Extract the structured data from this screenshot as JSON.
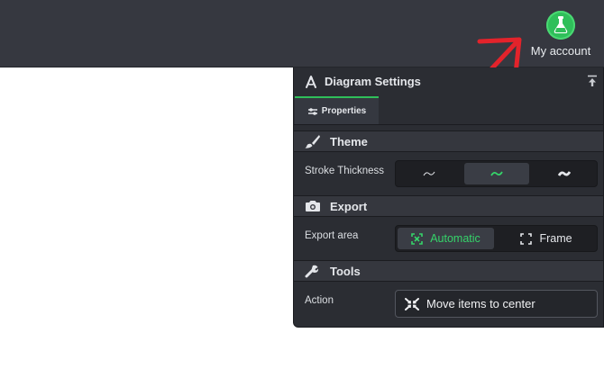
{
  "account": {
    "label": "My account",
    "icon": "flask-avatar-icon",
    "accent": "#2fbf5a"
  },
  "panel": {
    "title": "Diagram Settings",
    "title_icon": "compass-icon",
    "pin_icon": "pin-icon",
    "tabs": [
      {
        "label": "Properties",
        "icon": "sliders-icon",
        "active": true
      }
    ],
    "sections": [
      {
        "title": "Theme",
        "icon": "brush-icon"
      },
      {
        "title": "Export",
        "icon": "camera-icon"
      },
      {
        "title": "Tools",
        "icon": "wrench-icon"
      }
    ],
    "stroke": {
      "label": "Stroke Thickness",
      "options": [
        "thin-stroke-icon",
        "medium-stroke-icon",
        "thick-stroke-icon"
      ],
      "selected": 1
    },
    "export": {
      "label": "Export area",
      "options": [
        {
          "label": "Automatic",
          "icon": "auto-area-icon"
        },
        {
          "label": "Frame",
          "icon": "frame-icon"
        }
      ],
      "selected": 0
    },
    "tools": {
      "label": "Action",
      "button_label": "Move items to center",
      "button_icon": "center-arrows-icon"
    }
  },
  "colors": {
    "accent_green": "#2fbf5a",
    "annotation_red": "#e3232b",
    "topbar": "#363840",
    "panel": "#2b2d33"
  }
}
